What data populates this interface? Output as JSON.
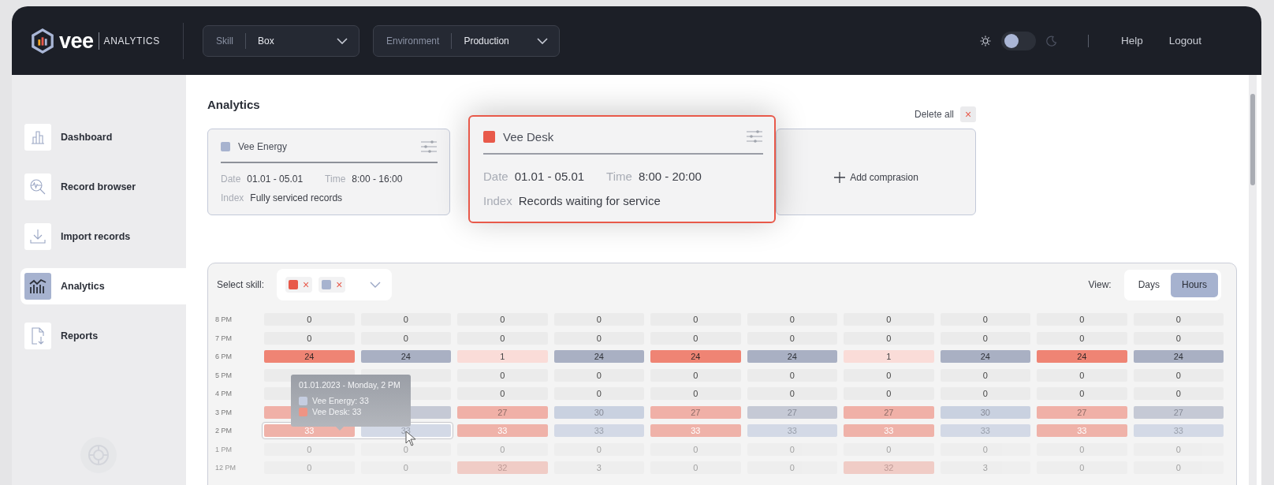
{
  "header": {
    "logo_word": "vee",
    "logo_sub": "ANALYTICS",
    "dropdowns": [
      {
        "label": "Skill",
        "value": "Box"
      },
      {
        "label": "Environment",
        "value": "Production"
      }
    ],
    "theme_toggle": {
      "on": false
    },
    "links": [
      "Help",
      "Logout"
    ]
  },
  "sidebar": {
    "items": [
      {
        "label": "Dashboard",
        "selected": false
      },
      {
        "label": "Record browser",
        "selected": false
      },
      {
        "label": "Import records",
        "selected": false
      },
      {
        "label": "Analytics",
        "selected": true
      },
      {
        "label": "Reports",
        "selected": false
      }
    ]
  },
  "page": {
    "title": "Analytics",
    "delete_all": "Delete all",
    "delete_icon": "×",
    "cards": [
      {
        "kind": "skill",
        "name": "Vee Energy",
        "color": "#a7b3cf",
        "selected": false,
        "date_label": "Date",
        "date": "01.01 - 05.01",
        "time_label": "Time",
        "time": "8:00 - 16:00",
        "index_label": "Index",
        "index": "Fully serviced records"
      },
      {
        "kind": "skill",
        "name": "Vee Desk",
        "color": "#e8594a",
        "selected": true,
        "date_label": "Date",
        "date": "01.01 - 05.01",
        "time_label": "Time",
        "time": "8:00 - 20:00",
        "index_label": "Index",
        "index": "Records waiting for service"
      },
      {
        "kind": "add",
        "label": "Add comprasion"
      }
    ]
  },
  "heatmap": {
    "select_label": "Select skill:",
    "chips": [
      {
        "color": "#e8594a",
        "remove": "×"
      },
      {
        "color": "#a7b3cf",
        "remove": "×"
      }
    ],
    "view_label": "View:",
    "views": [
      {
        "label": "Days",
        "selected": false
      },
      {
        "label": "Hours",
        "selected": true
      }
    ],
    "rows": [
      {
        "label": "8 PM",
        "faded": false,
        "selected": false,
        "cells": [
          {
            "kind": "empty",
            "value": "0"
          },
          {
            "kind": "empty",
            "value": "0"
          },
          {
            "kind": "empty",
            "value": "0"
          },
          {
            "kind": "empty",
            "value": "0"
          },
          {
            "kind": "empty",
            "value": "0"
          },
          {
            "kind": "empty",
            "value": "0"
          },
          {
            "kind": "empty",
            "value": "0"
          },
          {
            "kind": "empty",
            "value": "0"
          },
          {
            "kind": "empty",
            "value": "0"
          },
          {
            "kind": "empty",
            "value": "0"
          }
        ]
      },
      {
        "label": "7 PM",
        "faded": false,
        "selected": false,
        "cells": [
          {
            "kind": "empty",
            "value": "0"
          },
          {
            "kind": "empty",
            "value": "0"
          },
          {
            "kind": "empty",
            "value": "0"
          },
          {
            "kind": "empty",
            "value": "0"
          },
          {
            "kind": "empty",
            "value": "0"
          },
          {
            "kind": "empty",
            "value": "0"
          },
          {
            "kind": "empty",
            "value": "0"
          },
          {
            "kind": "empty",
            "value": "0"
          },
          {
            "kind": "empty",
            "value": "0"
          },
          {
            "kind": "empty",
            "value": "0"
          }
        ]
      },
      {
        "label": "6 PM",
        "faded": false,
        "selected": false,
        "cells": [
          {
            "kind": "red",
            "value": "24"
          },
          {
            "kind": "blue",
            "value": "24"
          },
          {
            "kind": "pink",
            "value": "1"
          },
          {
            "kind": "blue",
            "value": "24"
          },
          {
            "kind": "red",
            "value": "24"
          },
          {
            "kind": "blue",
            "value": "24"
          },
          {
            "kind": "pink",
            "value": "1"
          },
          {
            "kind": "blue",
            "value": "24"
          },
          {
            "kind": "red",
            "value": "24"
          },
          {
            "kind": "blue",
            "value": "24"
          }
        ]
      },
      {
        "label": "5 PM",
        "faded": false,
        "selected": false,
        "cells": [
          {
            "kind": "empty"
          },
          {
            "kind": "empty"
          },
          {
            "kind": "empty",
            "value": "0"
          },
          {
            "kind": "empty",
            "value": "0"
          },
          {
            "kind": "empty",
            "value": "0"
          },
          {
            "kind": "empty",
            "value": "0"
          },
          {
            "kind": "empty",
            "value": "0"
          },
          {
            "kind": "empty",
            "value": "0"
          },
          {
            "kind": "empty",
            "value": "0"
          },
          {
            "kind": "empty",
            "value": "0"
          }
        ]
      },
      {
        "label": "4 PM",
        "faded": false,
        "selected": false,
        "cells": [
          {
            "kind": "empty"
          },
          {
            "kind": "empty"
          },
          {
            "kind": "empty",
            "value": "0"
          },
          {
            "kind": "empty",
            "value": "0"
          },
          {
            "kind": "empty",
            "value": "0"
          },
          {
            "kind": "empty",
            "value": "0"
          },
          {
            "kind": "empty",
            "value": "0"
          },
          {
            "kind": "empty",
            "value": "0"
          },
          {
            "kind": "empty",
            "value": "0"
          },
          {
            "kind": "empty",
            "value": "0"
          }
        ]
      },
      {
        "label": "3 PM",
        "faded": false,
        "selected": false,
        "cells": [
          {
            "kind": "salmon"
          },
          {
            "kind": "slate"
          },
          {
            "kind": "salmon",
            "value": "27"
          },
          {
            "kind": "lightblue",
            "value": "30"
          },
          {
            "kind": "salmon",
            "value": "27"
          },
          {
            "kind": "slate",
            "value": "27"
          },
          {
            "kind": "salmon",
            "value": "27"
          },
          {
            "kind": "lightblue",
            "value": "30"
          },
          {
            "kind": "salmon",
            "value": "27"
          },
          {
            "kind": "slate",
            "value": "27"
          }
        ]
      },
      {
        "label": "2 PM",
        "faded": false,
        "selected": true,
        "cells": [
          {
            "kind": "rose",
            "value": "33"
          },
          {
            "kind": "pale",
            "value": "33"
          },
          {
            "kind": "rose",
            "value": "33"
          },
          {
            "kind": "pale",
            "value": "33"
          },
          {
            "kind": "rose",
            "value": "33"
          },
          {
            "kind": "pale",
            "value": "33"
          },
          {
            "kind": "rose",
            "value": "33"
          },
          {
            "kind": "pale",
            "value": "33"
          },
          {
            "kind": "rose",
            "value": "33"
          },
          {
            "kind": "pale",
            "value": "33"
          }
        ]
      },
      {
        "label": "1 PM",
        "faded": true,
        "selected": false,
        "cells": [
          {
            "kind": "empty",
            "value": "0"
          },
          {
            "kind": "empty",
            "value": "0"
          },
          {
            "kind": "empty",
            "value": "0"
          },
          {
            "kind": "empty",
            "value": "0"
          },
          {
            "kind": "empty",
            "value": "0"
          },
          {
            "kind": "empty",
            "value": "0"
          },
          {
            "kind": "empty",
            "value": "0"
          },
          {
            "kind": "empty",
            "value": "0"
          },
          {
            "kind": "empty",
            "value": "0"
          },
          {
            "kind": "empty",
            "value": "0"
          }
        ]
      },
      {
        "label": "12 PM",
        "faded": true,
        "selected": false,
        "cells": [
          {
            "kind": "empty",
            "value": "0"
          },
          {
            "kind": "empty",
            "value": "0"
          },
          {
            "kind": "rose",
            "value": "32"
          },
          {
            "kind": "empty",
            "value": "3"
          },
          {
            "kind": "empty",
            "value": "0"
          },
          {
            "kind": "empty",
            "value": "0"
          },
          {
            "kind": "rose",
            "value": "32"
          },
          {
            "kind": "empty",
            "value": "3"
          },
          {
            "kind": "empty",
            "value": "0"
          },
          {
            "kind": "empty",
            "value": "0"
          }
        ]
      }
    ],
    "tooltip": {
      "title": "01.01.2023 - Monday, 2 PM",
      "items": [
        {
          "label": "Vee Energy: 33",
          "color": "#c5cde0"
        },
        {
          "label": "Vee Desk: 33",
          "color": "#ee9484"
        }
      ]
    }
  }
}
